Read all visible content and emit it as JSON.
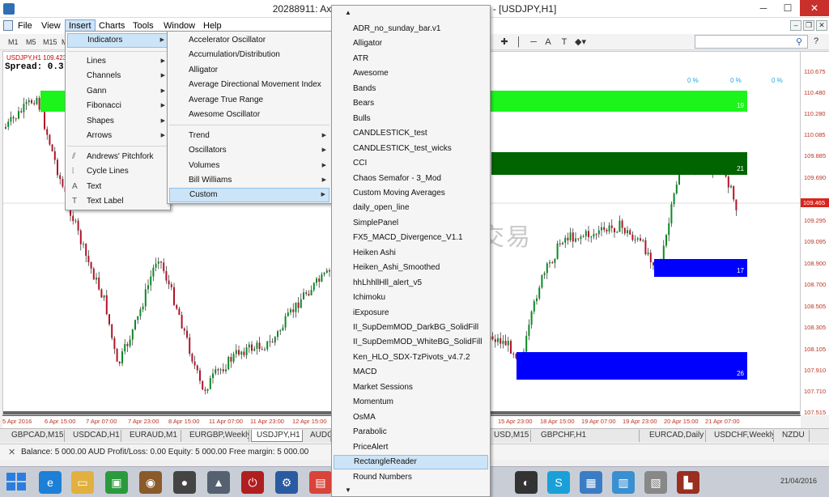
{
  "window": {
    "title": "20288911: AxiTrader-US02-Demo - Demo Account - [USDJPY,H1]",
    "min": "─",
    "max": "☐",
    "close": "✕"
  },
  "menubar": {
    "items": [
      "File",
      "View",
      "Insert",
      "Charts",
      "Tools",
      "Window",
      "Help"
    ],
    "mdi_min": "–",
    "mdi_restore": "❐",
    "mdi_close": "✕"
  },
  "toolbar": {
    "timeframes": [
      "M1",
      "M5",
      "M15",
      "M"
    ]
  },
  "insert_menu": {
    "items": [
      {
        "label": "Indicators",
        "icon": "",
        "submenu": true,
        "highlighted": true
      },
      {
        "label": "Lines",
        "icon": "",
        "submenu": true
      },
      {
        "label": "Channels",
        "icon": "",
        "submenu": true
      },
      {
        "label": "Gann",
        "icon": "",
        "submenu": true
      },
      {
        "label": "Fibonacci",
        "icon": "",
        "submenu": true
      },
      {
        "label": "Shapes",
        "icon": "",
        "submenu": true
      },
      {
        "label": "Arrows",
        "icon": "",
        "submenu": true
      },
      {
        "label": "Andrews' Pitchfork",
        "icon": "pitchfork-icon",
        "submenu": false
      },
      {
        "label": "Cycle Lines",
        "icon": "cycle-lines-icon",
        "submenu": false
      },
      {
        "label": "Text",
        "icon": "text-icon",
        "submenu": false
      },
      {
        "label": "Text Label",
        "icon": "text-label-icon",
        "submenu": false
      }
    ]
  },
  "indicators_menu": {
    "items": [
      {
        "label": "Accelerator Oscillator",
        "submenu": false
      },
      {
        "label": "Accumulation/Distribution",
        "submenu": false
      },
      {
        "label": "Alligator",
        "submenu": false
      },
      {
        "label": "Average Directional Movement Index",
        "submenu": false
      },
      {
        "label": "Average True Range",
        "submenu": false
      },
      {
        "label": "Awesome Oscillator",
        "submenu": false
      },
      {
        "label": "Trend",
        "submenu": true
      },
      {
        "label": "Oscillators",
        "submenu": true
      },
      {
        "label": "Volumes",
        "submenu": true
      },
      {
        "label": "Bill Williams",
        "submenu": true
      },
      {
        "label": "Custom",
        "submenu": true,
        "highlighted": true
      }
    ]
  },
  "custom_menu": {
    "items": [
      "ADR_no_sunday_bar.v1",
      "Alligator",
      "ATR",
      "Awesome",
      "Bands",
      "Bears",
      "Bulls",
      "CANDLESTICK_test",
      "CANDLESTICK_test_wicks",
      "CCI",
      "Chaos Semafor - 3_Mod",
      "Custom Moving Averages",
      "daily_open_line",
      "SimplePanel",
      "FX5_MACD_Divergence_V1.1",
      "Heiken Ashi",
      "Heiken_Ashi_Smoothed",
      "hhLhhllHll_alert_v5",
      "Ichimoku",
      "iExposure",
      "II_SupDemMOD_DarkBG_SolidFill",
      "II_SupDemMOD_WhiteBG_SolidFill",
      "Ken_HLO_SDX-TzPivots_v4.7.2",
      "MACD",
      "Market Sessions",
      "Momentum",
      "OsMA",
      "Parabolic",
      "PriceAlert",
      "RectangleReader",
      "Round Numbers"
    ],
    "highlighted": "RectangleReader",
    "scroll_up": "▲",
    "scroll_down": "▼"
  },
  "chart": {
    "symbol_label": "USDJPY,H1  109.423",
    "spread": "Spread: 0.3",
    "percent_labels": [
      "0 %",
      "0 %",
      "0 %"
    ],
    "watermark": "图道交易",
    "zones": [
      {
        "number": "19",
        "color": "#1cf51c"
      },
      {
        "number": "21",
        "color": "#006400"
      },
      {
        "number": "17",
        "color": "#0000ff"
      },
      {
        "number": "26",
        "color": "#0000ff"
      }
    ],
    "price_ticks": [
      "110.675",
      "110.480",
      "110.280",
      "110.085",
      "109.885",
      "109.690",
      "109.295",
      "109.095",
      "108.900",
      "108.700",
      "108.505",
      "108.305",
      "108.105",
      "107.910",
      "107.710",
      "107.515"
    ],
    "current_price": "109.465",
    "time_ticks": [
      "5 Apr 2016",
      "6 Apr 15:00",
      "7 Apr 07:00",
      "7 Apr 23:00",
      "8 Apr 15:00",
      "11 Apr 07:00",
      "11 Apr 23:00",
      "12 Apr 15:00",
      "15 Apr 23:00",
      "18 Apr 15:00",
      "19 Apr 07:00",
      "19 Apr 23:00",
      "20 Apr 15:00",
      "21 Apr 07:00"
    ]
  },
  "chart_tabs": {
    "items": [
      "GBPCAD,M15",
      "USDCAD,H1",
      "EURAUD,M1",
      "EURGBP,Weekly",
      "USDJPY,H1",
      "AUDC",
      "USD,M15",
      "GBPCHF,H1",
      "EURCAD,Daily",
      "USDCHF,Weekly",
      "NZDU"
    ],
    "active": "USDJPY,H1"
  },
  "status": {
    "close": "✕",
    "text": "Balance: 5 000.00 AUD  Profit/Loss: 0.00  Equity: 5 000.00  Free margin: 5 000.00"
  },
  "taskbar": {
    "time": "21/04/2016"
  }
}
